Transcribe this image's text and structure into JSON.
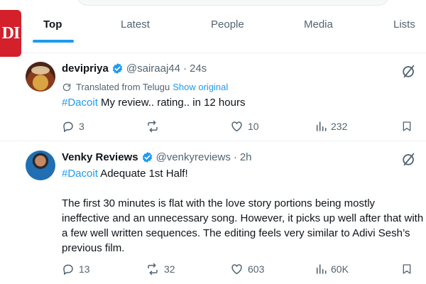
{
  "logo": {
    "text": "DI"
  },
  "tabs": [
    {
      "label": "Top",
      "active": true
    },
    {
      "label": "Latest"
    },
    {
      "label": "People"
    },
    {
      "label": "Media"
    },
    {
      "label": "Lists"
    }
  ],
  "posts": [
    {
      "display_name": "devipriya",
      "handle": "@sairaaj44",
      "separator": "·",
      "time": "24s",
      "translated_label": "Translated from Telugu",
      "show_original": "Show original",
      "hashtag": "#Dacoit",
      "text": " My review.. rating.. in 12 hours",
      "replies": "3",
      "reposts": "",
      "likes": "10",
      "views": "232"
    },
    {
      "display_name": "Venky Reviews",
      "handle": "@venkyreviews",
      "separator": "·",
      "time": "2h",
      "hashtag": "#Dacoit",
      "text": " Adequate 1st Half!",
      "paragraph": "The first 30 minutes is flat with the love story portions being mostly ineffective and an unnecessary song. However, it picks up well after that with a few well written sequences. The editing feels very similar to Adivi Sesh’s previous film.",
      "replies": "13",
      "reposts": "32",
      "likes": "603",
      "views": "60K"
    }
  ],
  "colors": {
    "accent": "#1d9bf0",
    "text": "#0f1419",
    "muted": "#536471",
    "badge": "#d3202b"
  },
  "icons": [
    "verified-badge-icon",
    "grok-icon",
    "translate-icon",
    "reply-icon",
    "repost-icon",
    "like-icon",
    "views-icon",
    "bookmark-icon"
  ]
}
